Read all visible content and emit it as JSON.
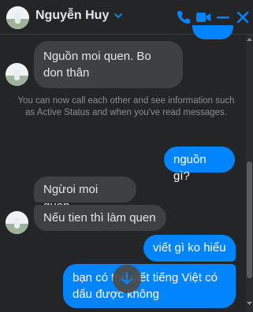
{
  "header": {
    "name": "Nguyễn Huy",
    "icons": [
      "chevron-down-icon",
      "phone-icon",
      "video-camera-icon",
      "minimize-icon",
      "close-icon"
    ]
  },
  "messages": {
    "m1": "Nguồn moi quen. Bo don thân",
    "info": "You can now call each other and see information such as Active Status and when you've read messages.",
    "m2": "nguồn gì?",
    "m3": "Ngừoi moi quen",
    "m4": "Nếu tien thì làm quen",
    "m5": "viết gì ko hiểu",
    "m6": "bạn có thể viết tiếng Việt có dấu được không"
  },
  "colors": {
    "accent": "#0084ff",
    "background": "#242526",
    "incoming_bubble": "#3e4042"
  }
}
